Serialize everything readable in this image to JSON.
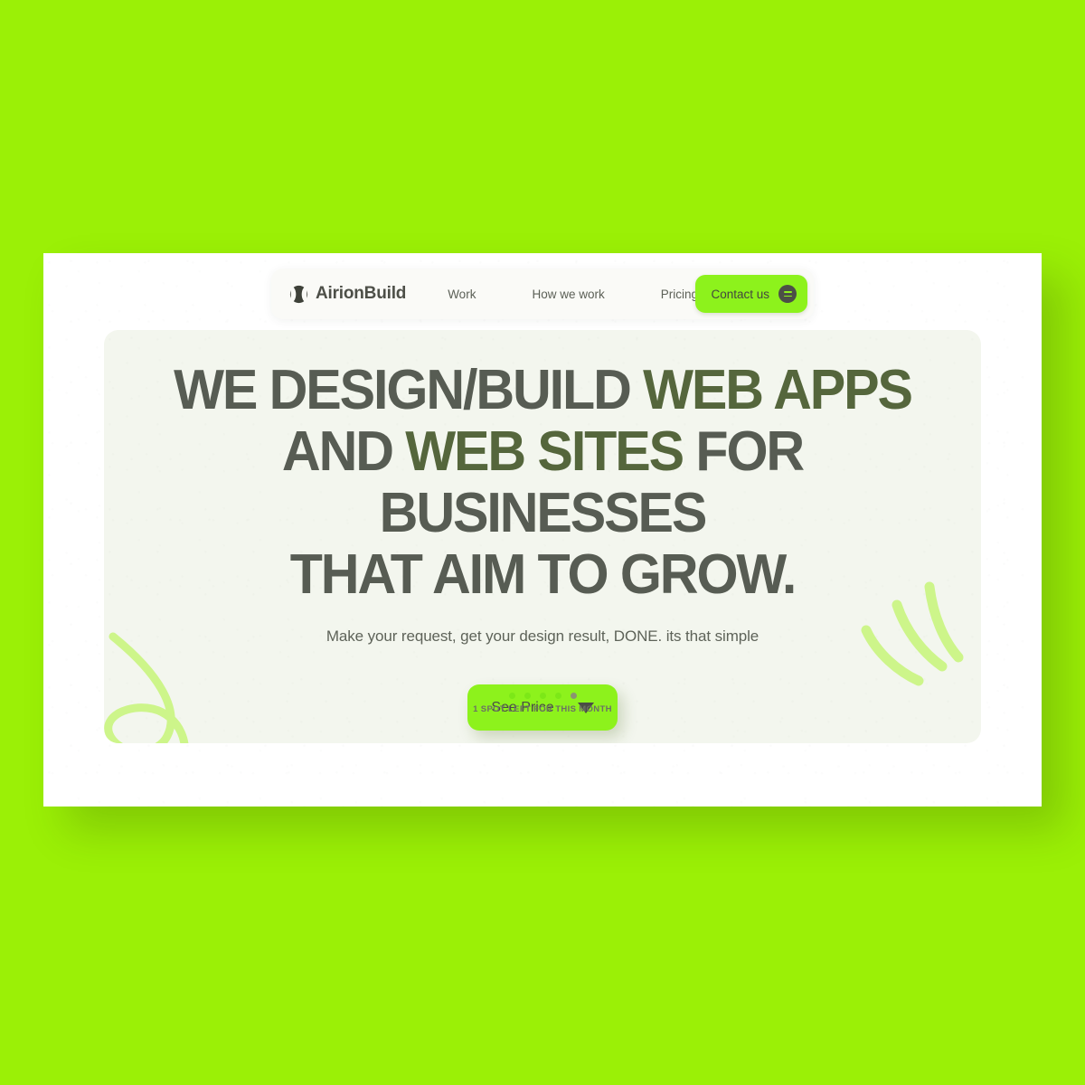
{
  "page": {
    "background_color": "#9BF006",
    "panel_background": "#FFFFFF",
    "hero_card_background": "#F3F6EE",
    "accent_green": "#8DF21C",
    "accent_olive": "#55663C",
    "heading_color": "#575C53"
  },
  "navbar": {
    "brand": {
      "name": "AirionBuild",
      "mark_icon": "sphere-logo-icon"
    },
    "links": [
      {
        "label": "Work"
      },
      {
        "label": "How we work"
      },
      {
        "label": "Pricing"
      }
    ],
    "contact_button": {
      "label": "Contact us",
      "icon": "menu-circle-icon"
    }
  },
  "hero": {
    "headline": {
      "line1_part1": "WE DESIGN/BUILD ",
      "line1_accent": "WEB APPS",
      "line2_part1": "AND ",
      "line2_accent": "WEB SITES",
      "line2_part2": " FOR BUSINESSES",
      "line3": "THAT AIM TO GROW."
    },
    "subtitle": "Make your request, get your design result, DONE. its that simple",
    "cta": {
      "label": "See Price",
      "icon": "caret-down-icon"
    },
    "availability": {
      "label": "1 SPOT LEFT FOR THIS MONTH",
      "total_slots": 5,
      "remaining_slots": 4,
      "dot_active_color": "#7CE817",
      "dot_used_color": "#8A9471"
    },
    "decorations": {
      "left": "loop-squiggle-doodle",
      "right": "motion-arcs-doodle",
      "doodle_color": "#CDF58A"
    }
  }
}
